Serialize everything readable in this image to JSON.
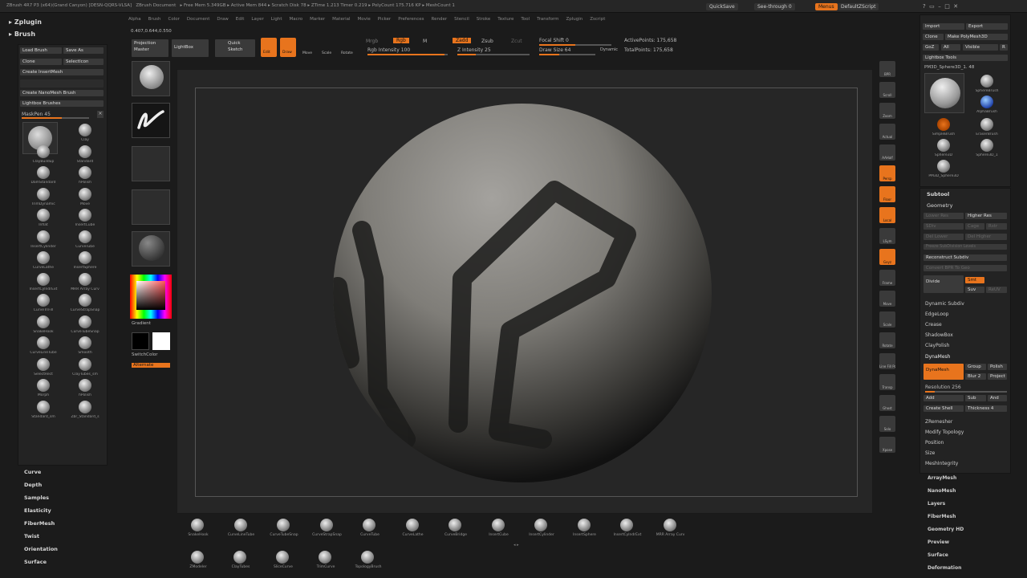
{
  "app": {
    "title": "ZBrush 4R7 P3 (x64)(Grand Canyon) [DESN-QQRS-VLSA]",
    "doc": "ZBrush Document",
    "stats": "▸ Free Mem 5.349GB ▸ Active Mem 844 ▸ Scratch Disk 78 ▸ ZTime 1.213 Timer 0.219 ▸ PolyCount 175.716 KP ▸ MeshCount 1"
  },
  "titlebar": {
    "quicksave": "QuickSave",
    "seethrough": "See-through 0",
    "menus": "Menus",
    "script": "DefaultZScript"
  },
  "menubar": [
    "Alpha",
    "Brush",
    "Color",
    "Document",
    "Draw",
    "Edit",
    "Layer",
    "Light",
    "Macro",
    "Marker",
    "Material",
    "Movie",
    "Picker",
    "Preferences",
    "Render",
    "Stencil",
    "Stroke",
    "Texture",
    "Tool",
    "Transform",
    "Zplugin",
    "Zscript"
  ],
  "coords": "0.407,0.644,0.550",
  "top_toolbar": {
    "projection_master": "Projection Master",
    "lightbox": "LightBox",
    "quick_sketch": "Quick Sketch",
    "edit": "Edit",
    "draw": "Draw",
    "move": "Move",
    "scale": "Scale",
    "rotate": "Rotate",
    "mrgb": "Mrgb",
    "rgb": "Rgb",
    "m": "M",
    "rgb_intensity": "Rgb Intensity 100",
    "zadd": "Zadd",
    "zsub": "Zsub",
    "zcut": "Zcut",
    "z_intensity": "Z Intensity 25",
    "focal_shift": "Focal Shift 0",
    "draw_size": "Draw Size 64",
    "dynamic": "Dynamic",
    "active_points": "ActivePoints: 175,658",
    "total_points": "TotalPoints: 175,658"
  },
  "left_panel": {
    "zplugin": "Zplugin",
    "brush": "Brush",
    "load_brush": "Load Brush",
    "save_as": "Save As",
    "clone": "Clone",
    "select_icon": "SelectIcon",
    "create_insertmesh": "Create InsertMesh",
    "create_nanomesh_brush": "Create NanoMesh Brush",
    "lightbox_brushes": "Lightbox Brushes",
    "maskpen": "MaskPen 45",
    "brushes": [
      "Clay",
      "ClayBuildup",
      "Standard",
      "DamStandard",
      "hPolish",
      "TrimDynamic",
      "Move",
      "Inflat",
      "InsertCube",
      "InsertCylinder",
      "CurveTube",
      "CurveLathe",
      "InsertSphere",
      "InsertCylndrExt",
      "MRR Array Curv",
      "CurveTriFill",
      "CurveStrapSnap",
      "SnakeHook",
      "CurveTubeSnap",
      "CurveLineTube",
      "Smooth",
      "SelectRect",
      "ClayTubes_sm",
      "Morph",
      "hPolish",
      "Standard_sm",
      "Zbr_Standard_s"
    ],
    "subpalettes": [
      "Curve",
      "Depth",
      "Samples",
      "Elasticity",
      "FiberMesh",
      "Twist",
      "Orientation",
      "Surface"
    ]
  },
  "left_column": {
    "gradient": "Gradient",
    "switch_color": "SwitchColor",
    "alternate": "Alternate"
  },
  "right_shelf": [
    "BPR",
    "Scroll",
    "Zoom",
    "Actual",
    "AAHalf",
    "Persp",
    "Floor",
    "Local",
    "LSym",
    "Gxyz",
    "Frame",
    "Move",
    "Scale",
    "Rotate",
    "Line Fill PolyF",
    "Transp",
    "Ghost",
    "Solo",
    "Xpose"
  ],
  "right_panel": {
    "import": "Import",
    "export": "Export",
    "clone": "Clone",
    "make_polymesh3d": "Make PolyMesh3D",
    "goz": "GoZ",
    "all": "All",
    "visible": "Visible",
    "r": "R",
    "lightbox_tools": "Lightbox Tools",
    "current_tool": "PM3D_Sphere3D_1. 48",
    "tools": [
      "SphereBrush",
      "AlphaBrush",
      "SimpleBrush",
      "EraserBrush",
      "Sphere3D",
      "Sphere3D_1",
      "PM3D_Sphere3D"
    ],
    "subtool": "Subtool",
    "geometry": "Geometry",
    "lower_res": "Lower Res",
    "higher_res": "Higher Res",
    "sdiv": "SDiv",
    "cage": "Cage",
    "rstr": "Rstr",
    "del_lower": "Del Lower",
    "del_higher": "Del Higher",
    "freeze_subdiv": "Freeze SubDivision Levels",
    "reconstruct": "Reconstruct Subdiv",
    "convert_bpr": "Convert BPR To Geo",
    "divide": "Divide",
    "smt": "Smt",
    "suv": "Suv",
    "reuv": "ReUV",
    "dynamic_subdiv": "Dynamic Subdiv",
    "edgeloop": "EdgeLoop",
    "crease": "Crease",
    "shadowbox": "ShadowBox",
    "claypolish": "ClayPolish",
    "dynamesh_hdr": "DynaMesh",
    "dynamesh": "DynaMesh",
    "group": "Group",
    "polish": "Polish",
    "blur": "Blur 2",
    "project": "Project",
    "resolution": "Resolution 256",
    "add": "Add",
    "sub": "Sub",
    "and": "And",
    "create_shell": "Create Shell",
    "thickness": "Thickness 4",
    "zremesher": "ZRemesher",
    "modify_topology": "Modify Topology",
    "position": "Position",
    "size": "Size",
    "meshintegrity": "MeshIntegrity",
    "lower_sections": [
      "ArrayMesh",
      "NanoMesh",
      "Layers",
      "FiberMesh",
      "Geometry HD",
      "Preview",
      "Surface",
      "Deformation"
    ]
  },
  "bottom_tray": {
    "row1": [
      "SnakeHook",
      "CurveLineTube",
      "CurveTubeSnap",
      "CurveStrapSnap",
      "CurveTube",
      "CurveLathe",
      "CurveBridge",
      "InsertCube",
      "InsertCylinder",
      "InsertSphere",
      "InsertCylndrExt",
      "MRR Array Curv"
    ],
    "row2": [
      "ZModeler",
      "ClayTubes",
      "SliceCurve",
      "TrimCurve",
      "TopologyBrush"
    ]
  },
  "colors": {
    "accent": "#e8741d",
    "panel": "#232323",
    "canvas": "#262626"
  }
}
